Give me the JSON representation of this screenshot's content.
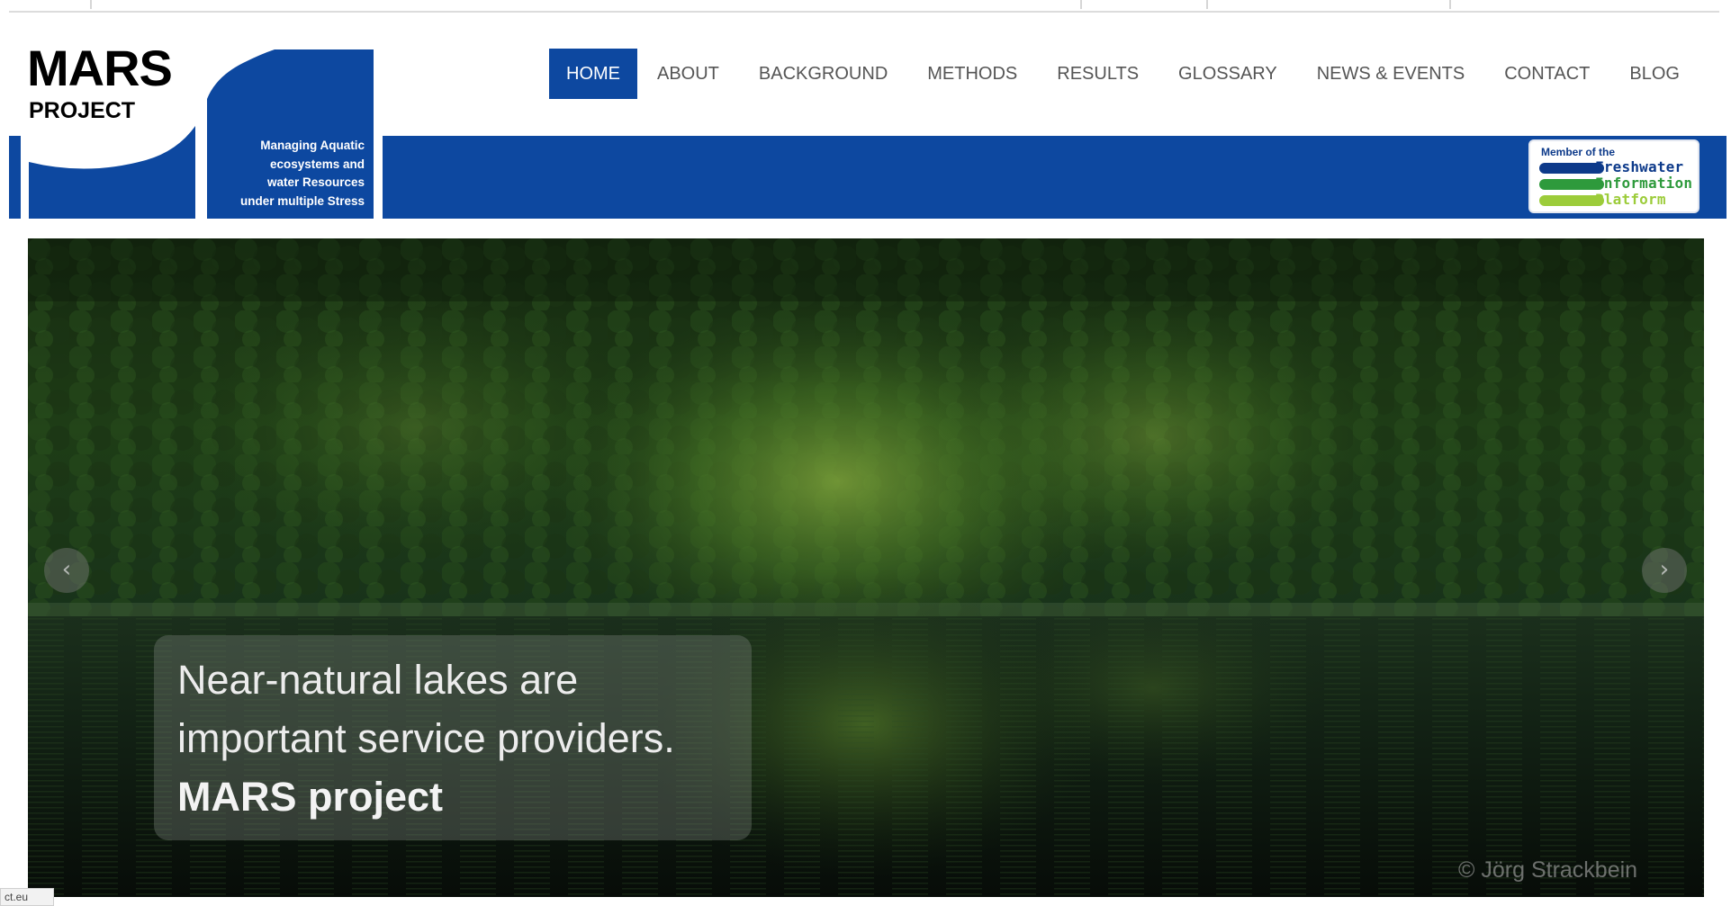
{
  "logo": {
    "title": "MARS",
    "subtitle": "PROJECT",
    "tagline": [
      "Managing Aquatic",
      "ecosystems and",
      "water Resources",
      "under multiple Stress"
    ]
  },
  "nav": {
    "items": [
      {
        "label": "HOME",
        "active": true
      },
      {
        "label": "ABOUT",
        "active": false
      },
      {
        "label": "BACKGROUND",
        "active": false
      },
      {
        "label": "METHODS",
        "active": false
      },
      {
        "label": "RESULTS",
        "active": false
      },
      {
        "label": "GLOSSARY",
        "active": false
      },
      {
        "label": "NEWS & EVENTS",
        "active": false
      },
      {
        "label": "CONTACT",
        "active": false
      },
      {
        "label": "BLOG",
        "active": false
      }
    ]
  },
  "badge": {
    "member_text": "Member of the",
    "words": [
      "Freshwater",
      "Information",
      "Platform"
    ]
  },
  "slider": {
    "caption_line1": "Near-natural lakes are",
    "caption_line2": "important service providers.",
    "caption_line3": "MARS project",
    "credit": "© Jörg Strackbein",
    "prev_icon": "chevron-left-icon",
    "next_icon": "chevron-right-icon"
  },
  "status_bar": {
    "url_fragment": "ct.eu"
  },
  "colors": {
    "brand_blue": "#0d48a0",
    "badge_blue": "#0d3a8a",
    "badge_green": "#2e9a3c",
    "badge_lime": "#9ccc3a",
    "nav_text": "#555555"
  }
}
